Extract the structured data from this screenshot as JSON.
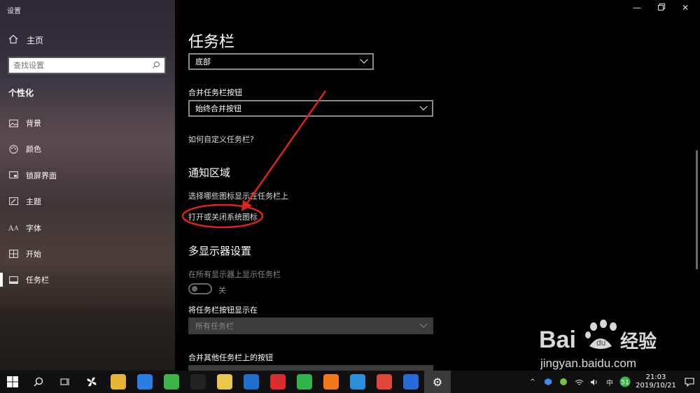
{
  "window": {
    "title": "设置"
  },
  "sidebar": {
    "home_label": "主页",
    "search_placeholder": "查找设置",
    "section_title": "个性化",
    "items": [
      {
        "label": "背景",
        "icon": "image-icon"
      },
      {
        "label": "颜色",
        "icon": "palette-icon"
      },
      {
        "label": "锁屏界面",
        "icon": "lock-screen-icon"
      },
      {
        "label": "主题",
        "icon": "theme-icon"
      },
      {
        "label": "字体",
        "icon": "font-icon"
      },
      {
        "label": "开始",
        "icon": "start-icon"
      },
      {
        "label": "任务栏",
        "icon": "taskbar-icon",
        "selected": true
      }
    ]
  },
  "main": {
    "title": "任务栏",
    "position_dropdown": {
      "value": "底部"
    },
    "combine_label": "合并任务栏按钮",
    "combine_dropdown": {
      "value": "始终合并按钮"
    },
    "customize_link": "如何自定义任务栏?",
    "notification_heading": "通知区域",
    "select_icons_link": "选择哪些图标显示在任务栏上",
    "system_icons_link": "打开或关闭系统图标",
    "multi_display_heading": "多显示器设置",
    "show_all_displays_label": "在所有显示器上显示任务栏",
    "toggle_state": "关",
    "show_buttons_label": "将任务栏按钮显示在",
    "show_buttons_dropdown": {
      "value": "所有任务栏"
    },
    "combine_other_label": "合并其他任务栏上的按钮"
  },
  "taskbar": {
    "apps": [
      {
        "name": "file-explorer-icon",
        "color": "#e8b632"
      },
      {
        "name": "store-icon",
        "color": "#2a7de1"
      },
      {
        "name": "browser-icon",
        "color": "#3db34a"
      },
      {
        "name": "qq-icon",
        "color": "#222222"
      },
      {
        "name": "app-yellow-icon",
        "color": "#e8c84a"
      },
      {
        "name": "app-blue-icon",
        "color": "#1f6fd1"
      },
      {
        "name": "app-red-icon",
        "color": "#d92c2c"
      },
      {
        "name": "wechat-icon",
        "color": "#2fb34a"
      },
      {
        "name": "app-orange-icon",
        "color": "#f07a18"
      },
      {
        "name": "app-circle-blue-icon",
        "color": "#2a8ed8"
      },
      {
        "name": "app-red-power-icon",
        "color": "#e0463a"
      },
      {
        "name": "wps-icon",
        "color": "#2a6ad8"
      },
      {
        "name": "settings-icon",
        "color": "#3a3a3a"
      }
    ],
    "time": "21:03",
    "date": "2019/10/21"
  },
  "watermark": {
    "text": "jingyan.baidu.com"
  }
}
